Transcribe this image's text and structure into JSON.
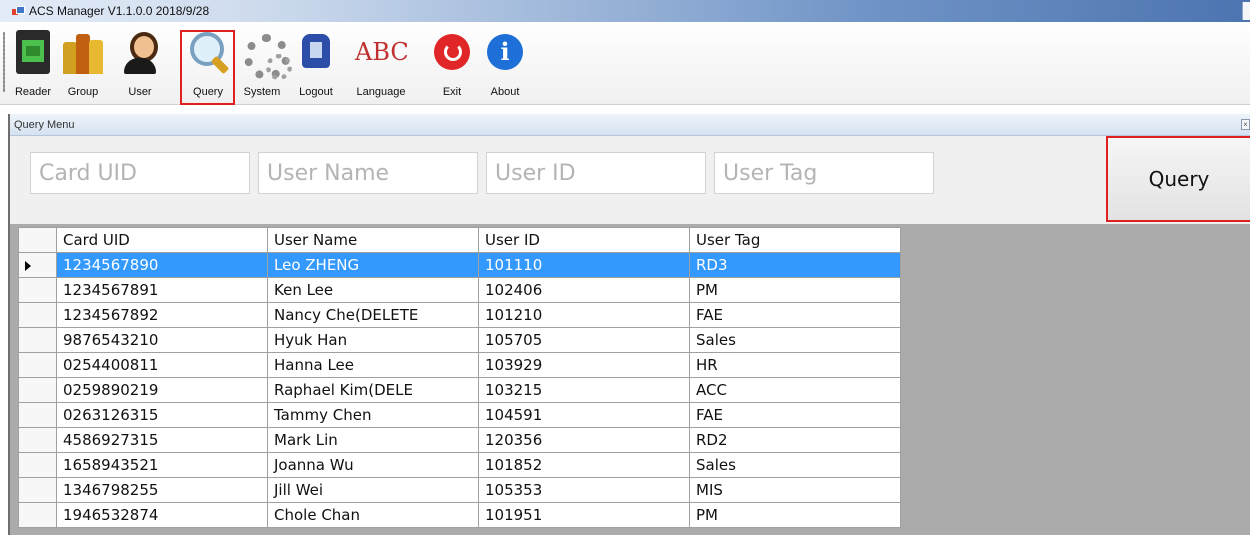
{
  "window": {
    "title": "ACS Manager V1.1.0.0  2018/9/28"
  },
  "toolbar": {
    "items": [
      {
        "label": "Reader",
        "icon": "reader-icon"
      },
      {
        "label": "Group",
        "icon": "group-icon"
      },
      {
        "label": "User",
        "icon": "user-icon"
      },
      {
        "label": "Query",
        "icon": "magnifier-icon",
        "highlighted": true
      },
      {
        "label": "System",
        "icon": "gear-icon"
      },
      {
        "label": "Logout",
        "icon": "logout-icon"
      },
      {
        "label": "Language",
        "icon": "language-icon",
        "glyph": "ABC"
      },
      {
        "label": "Exit",
        "icon": "power-icon"
      },
      {
        "label": "About",
        "icon": "info-icon"
      }
    ]
  },
  "query_panel": {
    "title": "Query Menu",
    "close_glyph": "×",
    "fields": {
      "card_uid": {
        "placeholder": "Card UID",
        "value": ""
      },
      "user_name": {
        "placeholder": "User Name",
        "value": ""
      },
      "user_id": {
        "placeholder": "User ID",
        "value": ""
      },
      "user_tag": {
        "placeholder": "User Tag",
        "value": ""
      }
    },
    "query_button": "Query",
    "highlight_color": "#e02020"
  },
  "grid": {
    "columns": [
      "Card UID",
      "User Name",
      "User ID",
      "User Tag"
    ],
    "selected_row": 0,
    "selection_color": "#3399ff",
    "rows": [
      [
        "1234567890",
        "Leo ZHENG",
        "101110",
        "RD3"
      ],
      [
        "1234567891",
        "Ken Lee",
        "102406",
        "PM"
      ],
      [
        "1234567892",
        "Nancy Che(DELETE",
        "101210",
        "FAE"
      ],
      [
        "9876543210",
        "Hyuk Han",
        "105705",
        "Sales"
      ],
      [
        "0254400811",
        "Hanna Lee",
        "103929",
        "HR"
      ],
      [
        "0259890219",
        "Raphael Kim(DELE",
        "103215",
        "ACC"
      ],
      [
        "0263126315",
        "Tammy Chen",
        "104591",
        "FAE"
      ],
      [
        "4586927315",
        "Mark Lin",
        "120356",
        "RD2"
      ],
      [
        "1658943521",
        "Joanna Wu",
        "101852",
        "Sales"
      ],
      [
        "1346798255",
        "Jill Wei",
        "105353",
        "MIS"
      ],
      [
        "1946532874",
        "Chole Chan",
        "101951",
        "PM"
      ]
    ]
  }
}
